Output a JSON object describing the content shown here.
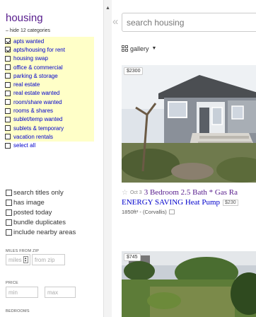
{
  "sidebar": {
    "category_title": "housing",
    "hide_link": "– hide 12 categories",
    "categories": [
      {
        "label": "apts wanted",
        "checked": true
      },
      {
        "label": "apts/housing for rent",
        "checked": true
      },
      {
        "label": "housing swap",
        "checked": false
      },
      {
        "label": "office & commercial",
        "checked": false
      },
      {
        "label": "parking & storage",
        "checked": false
      },
      {
        "label": "real estate",
        "checked": false
      },
      {
        "label": "real estate wanted",
        "checked": false
      },
      {
        "label": "room/share wanted",
        "checked": false
      },
      {
        "label": "rooms & shares",
        "checked": false
      },
      {
        "label": "sublet/temp wanted",
        "checked": false
      },
      {
        "label": "sublets & temporary",
        "checked": false
      },
      {
        "label": "vacation rentals",
        "checked": false
      }
    ],
    "select_all": "select all",
    "filters": [
      "search titles only",
      "has image",
      "posted today",
      "bundle duplicates",
      "include nearby areas"
    ],
    "miles_label": "MILES FROM ZIP",
    "miles_placeholder": "miles",
    "zip_placeholder": "from zip",
    "price_label": "PRICE",
    "min_placeholder": "min",
    "max_placeholder": "max",
    "bedrooms_label": "BEDROOMS"
  },
  "main": {
    "collapse_icon": "«",
    "search_placeholder": "search housing",
    "view_label": "gallery",
    "listings": [
      {
        "price": "$2300",
        "date": "Oct 3",
        "title_line1": "3 Bedroom 2.5 Bath * Gas Ra",
        "title_line2": "ENERGY SAVING Heat Pump",
        "inline_price": "$230",
        "meta": "1850ft² - (Corvallis)"
      },
      {
        "price": "$745"
      }
    ]
  }
}
